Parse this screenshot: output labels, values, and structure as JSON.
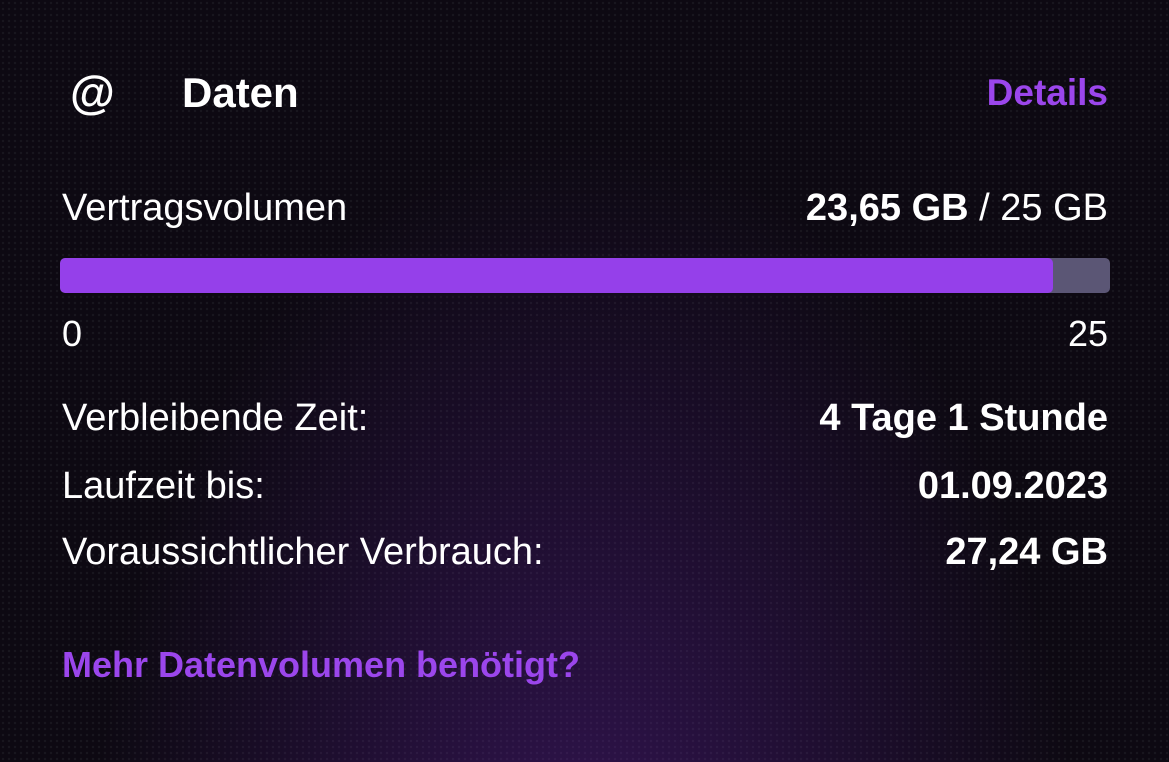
{
  "header": {
    "icon": "at-sign-icon",
    "icon_glyph": "@",
    "title": "Daten",
    "details_label": "Details"
  },
  "volume": {
    "label": "Vertragsvolumen",
    "used": "23,65 GB",
    "separator": "/",
    "total": "25 GB",
    "progress_fraction": 0.946,
    "scale_min": "0",
    "scale_max": "25"
  },
  "info": [
    {
      "label": "Verbleibende Zeit:",
      "value": "4 Tage 1 Stunde"
    },
    {
      "label": "Laufzeit bis:",
      "value": "01.09.2023"
    },
    {
      "label": "Voraussichtlicher Verbrauch:",
      "value": "27,24 GB"
    }
  ],
  "more_link": "Mehr Datenvolumen benötigt?",
  "colors": {
    "accent": "#9b46ec",
    "progress_fill": "#9540ea",
    "progress_track": "#5b5675",
    "background": "#0d0912",
    "text": "#ffffff"
  }
}
